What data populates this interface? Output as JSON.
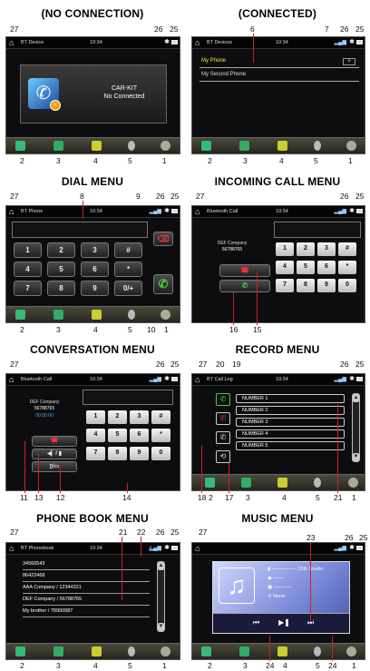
{
  "titles": {
    "no_connection": "(NO CONNECTION)",
    "connected": "(CONNECTED)",
    "dial": "DIAL MENU",
    "incoming": "INCOMING CALL MENU",
    "conversation": "CONVERSATION MENU",
    "record": "RECORD MENU",
    "phonebook": "PHONE BOOK MENU",
    "music": "MUSIC MENU"
  },
  "statusbar": {
    "clock": "10:34",
    "bt_device": "BT Device",
    "bt_devices": "BT Devices",
    "bt_phone": "BT Phone",
    "bluetooth_call": "Bluetooth Call",
    "bt_call_log": "BT Call Log",
    "bt_phonebook": "BT Phonebook"
  },
  "no_connection": {
    "line1": "CAR-KIT",
    "line2": "No Connected"
  },
  "connected": {
    "devices": [
      "My Phone",
      "My Second Phone"
    ]
  },
  "keypad": {
    "keys": [
      "1",
      "2",
      "3",
      "#",
      "4",
      "5",
      "6",
      "*",
      "7",
      "8",
      "9",
      "0/+"
    ]
  },
  "incoming": {
    "caller": "DEF Company",
    "number": "56788765",
    "keys": [
      "1",
      "2",
      "3",
      "#",
      "4",
      "5",
      "6",
      "*",
      "7",
      "8",
      "9",
      "0"
    ]
  },
  "conversation": {
    "caller": "DEF Company",
    "number": "56788765",
    "timer": "00:00:00",
    "keys": [
      "1",
      "2",
      "3",
      "#",
      "4",
      "5",
      "6",
      "*",
      "7",
      "8",
      "9",
      "0"
    ]
  },
  "record": {
    "entries": [
      "NUMBER 1",
      "NUMBER 2",
      "NUMBER 3",
      "NUMBER 4",
      "NUMBER 5"
    ]
  },
  "phonebook": {
    "entries": [
      "34566543",
      "86422468",
      "AAA Company / 12344321",
      "DEF Company / 56788765",
      "My brother / 78900987"
    ]
  },
  "music": {
    "album": "12th Studio",
    "status": "None"
  },
  "callouts": {
    "n1": "1",
    "n2": "2",
    "n3": "3",
    "n4": "4",
    "n5": "5",
    "n6": "6",
    "n7": "7",
    "n8": "8",
    "n9": "9",
    "n10": "10",
    "n11": "11",
    "n12": "12",
    "n13": "13",
    "n14": "14",
    "n15": "15",
    "n16": "16",
    "n17": "17",
    "n18": "18",
    "n19": "19",
    "n20": "20",
    "n21": "21",
    "n22": "22",
    "n23": "23",
    "n24": "24",
    "n25": "25",
    "n26": "26",
    "n27": "27"
  },
  "colors": {
    "accent_green": "#44cc44",
    "accent_red": "#dd2222",
    "selected_text": "#eeee33"
  }
}
